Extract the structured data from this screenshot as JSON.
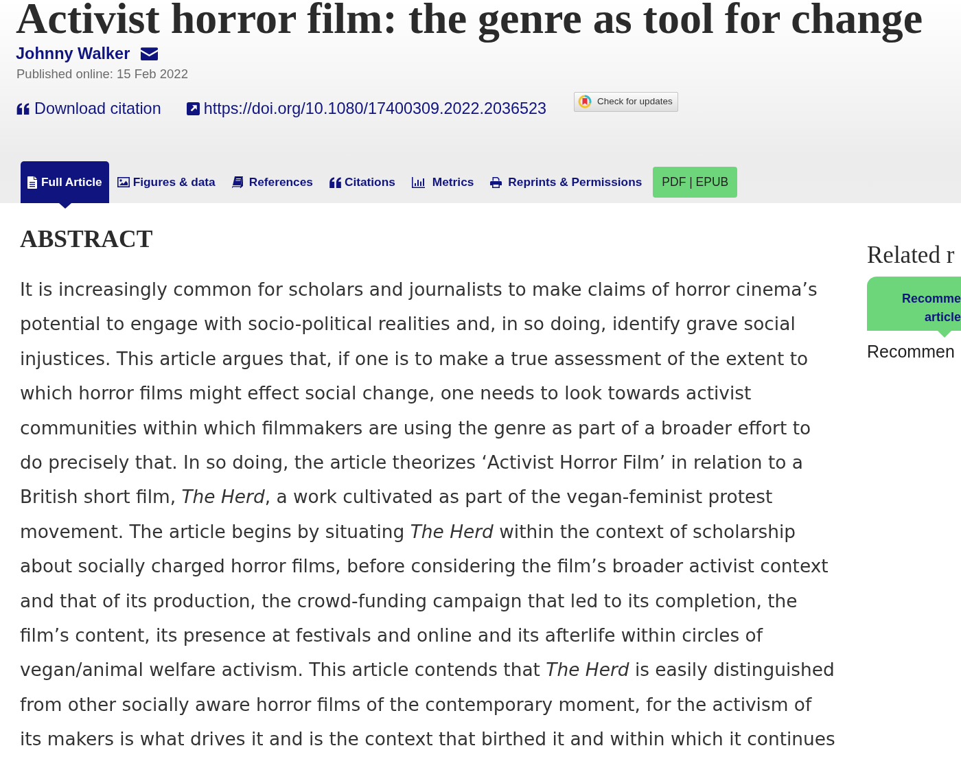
{
  "article": {
    "title": "Activist horror film: the genre as tool for change",
    "author": "Johnny Walker",
    "published": "Published online: 15 Feb 2022",
    "links": [
      "Download citation",
      "https://doi.org/10.1080/17400309.2022.2036523"
    ],
    "update_button": "Check for updates"
  },
  "tabs": [
    {
      "label": "Full Article",
      "selected": true
    },
    {
      "label": "Figures & data",
      "selected": false
    },
    {
      "label": "References",
      "selected": false
    },
    {
      "label": "Citations",
      "selected": false
    },
    {
      "label": "Metrics",
      "selected": false
    },
    {
      "label": "Reprints & Permissions",
      "selected": false
    }
  ],
  "pdf_button": "PDF | EPUB",
  "abstract": {
    "heading": "ABSTRACT",
    "text": "It is increasingly common for scholars and journalists to make claims of horror cinema’s\npotential to engage with socio-political realities and, in so doing, identify grave social\ninjustices. This article argues that, if one is to make a true assessment of the extent to\nwhich horror films might effect social change, one needs to look towards activist\ncommunities within which filmmakers are using the genre as part of a broader effort to\ndo precisely that. In so doing, the article theorizes ‘Activist Horror Film’ in relation to a\nBritish short film, *The Herd*, a work cultivated as part of the vegan-feminist protest\nmovement. The article begins by situating *The Herd* within the context of scholarship\nabout socially charged horror films, before considering the film’s broader activist context\nand that of its production, the crowd-funding campaign that led to its completion, the\nfilm’s content, its presence at festivals and online and its afterlife within circles of\nvegan/animal welfare activism. This article contends that *The Herd* is easily distinguished\nfrom other socially aware horror films of the contemporary moment, for the activism of\nits makers is what drives it and is the context that birthed it and within which it continues"
  },
  "sidebar": {
    "heading": "Related r",
    "tabs": [
      {
        "label": "Recomme article",
        "selected": true
      }
    ],
    "content": "Recommen"
  }
}
